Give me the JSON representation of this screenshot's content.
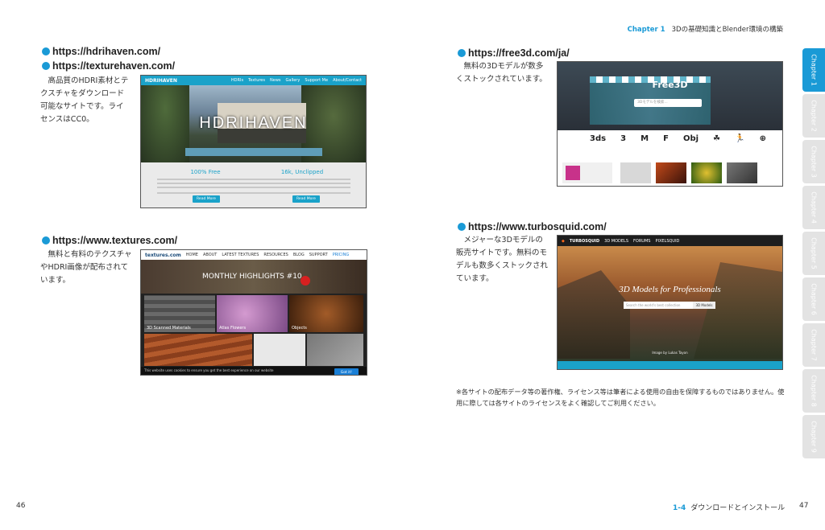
{
  "header": {
    "chapter_label": "Chapter 1",
    "chapter_title": "3Dの基礎知識とBlender環境の構築"
  },
  "sites": {
    "hdri": {
      "url1": "https://hdrihaven.com/",
      "url2": "https://texturehaven.com/",
      "description": "高品質のHDRI素材とテクスチャをダウンロード可能なサイトです。ライセンスはCC0。",
      "screenshot": {
        "logo": "HDRIHAVEN",
        "nav": [
          "HDRIs",
          "Textures",
          "News",
          "Gallery",
          "Support Me",
          "About/Contact"
        ],
        "col1_title": "100% Free",
        "col2_title": "16k, Unclipped",
        "read_more": "Read More"
      }
    },
    "free3d": {
      "url": "https://free3d.com/ja/",
      "description": "無料の3Dモデルが数多くストックされています。",
      "screenshot": {
        "title": "Free3D",
        "search_placeholder": "3Dモデルを検索...",
        "icons": [
          "3ds",
          "3",
          "M",
          "F",
          "Obj",
          "☘",
          "🏃",
          "⊕"
        ]
      }
    },
    "textures": {
      "url": "https://www.textures.com/",
      "description": "無料と有料のテクスチャやHDRI画像が配布されています。",
      "screenshot": {
        "logo": "textures.com",
        "nav": [
          "HOME",
          "ABOUT",
          "LATEST TEXTURES",
          "RESOURCES",
          "BLOG",
          "SUPPORT",
          "PRICING"
        ],
        "banner": "MONTHLY HIGHLIGHTS #10",
        "tile1": "3D Scanned Materials",
        "tile2": "Atlas Flowers",
        "tile3": "Objects",
        "cookie": "This website uses cookies to ensure you get the best experience on our website",
        "cookie_btn": "Got it!"
      }
    },
    "turbosquid": {
      "url": "https://www.turbosquid.com/",
      "description": "メジャーな3Dモデルの販売サイトです。無料のモデルも数多くストックされています。",
      "screenshot": {
        "logo": "TURBOSQUID",
        "nav": [
          "3D MODELS",
          "FORUMS",
          "PIXELSQUID"
        ],
        "headline": "3D Models for Professionals",
        "search_placeholder": "Search the world's best collection",
        "search_btn": "3D Models",
        "credit": "Image by Lukas Tayon"
      }
    }
  },
  "note": "※各サイトの配布データ等の著作権、ライセンス等は筆者による使用の自由を保障するものではありません。使用に際しては各サイトのライセンスをよく確認してご利用ください。",
  "footer": {
    "page_left": "46",
    "section_number": "1-4",
    "section_title": "ダウンロードとインストール",
    "page_right": "47"
  },
  "tabs": [
    "Chapter 1",
    "Chapter 2",
    "Chapter 3",
    "Chapter 4",
    "Chapter 5",
    "Chapter 6",
    "Chapter 7",
    "Chapter 8",
    "Chapter 9"
  ],
  "colors": {
    "accent": "#1a9ad6",
    "tab_inactive": "#e3e3e3"
  }
}
